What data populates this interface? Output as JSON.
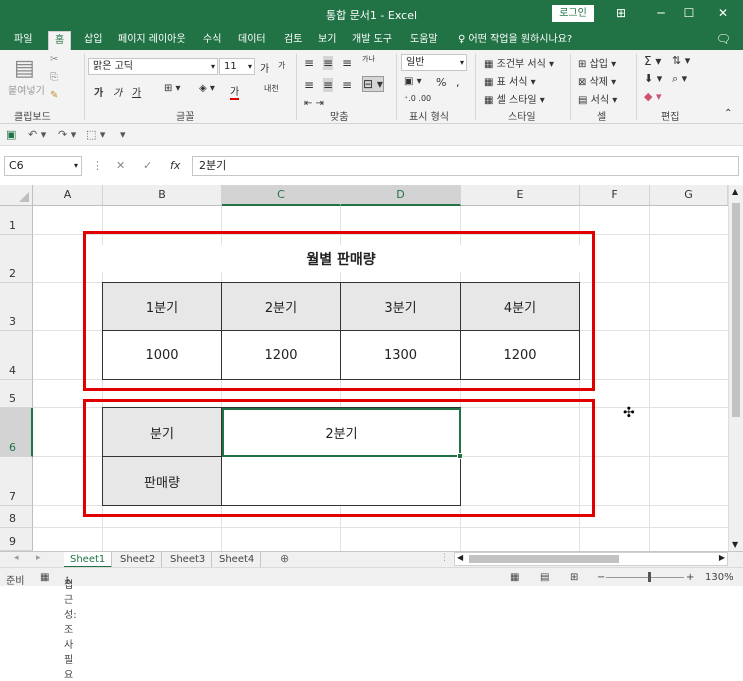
{
  "window": {
    "title": "통합 문서1 - Excel",
    "login_label": "로그인",
    "ribbon_options_icon": "ribbon-options-icon",
    "minimize": "─",
    "maximize": "☐",
    "close": "✕"
  },
  "menu": {
    "tabs": [
      "파일",
      "홈",
      "삽입",
      "페이지 레이아웃",
      "수식",
      "데이터",
      "검토",
      "보기",
      "개발 도구",
      "도움말"
    ],
    "tell_me": "어떤 작업을 원하시나요?"
  },
  "ribbon": {
    "clipboard": {
      "paste": "붙여넣기",
      "label": "클립보드"
    },
    "font": {
      "name": "맑은 고딕",
      "size": "11",
      "label": "글꼴",
      "bold": "가",
      "italic": "가",
      "underline": "가",
      "grow": "가",
      "shrink": "가",
      "font_color_label": "가",
      "phonetic": "내천"
    },
    "alignment": {
      "label": "맞춤",
      "wrap": "가나"
    },
    "number": {
      "format": "일반",
      "label": "표시 형식",
      "percent": "%",
      "comma": ","
    },
    "styles": {
      "conditional": "조건부 서식",
      "table": "표 서식",
      "cell_styles": "셀 스타일",
      "label": "스타일"
    },
    "cells": {
      "insert": "삽입",
      "delete": "삭제",
      "format": "서식",
      "label": "셀"
    },
    "editing": {
      "label": "편집"
    }
  },
  "formula_bar": {
    "name_box": "C6",
    "fx": "fx",
    "value": "2분기"
  },
  "columns": [
    "A",
    "B",
    "C",
    "D",
    "E",
    "F",
    "G"
  ],
  "rows": [
    "1",
    "2",
    "3",
    "4",
    "5",
    "6",
    "7",
    "8",
    "9"
  ],
  "selected_cell": {
    "column": "C",
    "row": "6"
  },
  "sheet": {
    "title": "월별 판매량",
    "quarters": [
      "1분기",
      "2분기",
      "3분기",
      "4분기"
    ],
    "sales": [
      "1000",
      "1200",
      "1300",
      "1200"
    ],
    "lookup": {
      "label_quarter": "분기",
      "value_quarter": "2분기",
      "label_sales": "판매량",
      "value_sales": ""
    }
  },
  "sheet_tabs": [
    "Sheet1",
    "Sheet2",
    "Sheet3",
    "Sheet4"
  ],
  "active_sheet": "Sheet1",
  "status": {
    "ready": "준비",
    "accessibility": "접근성: 조사 필요",
    "zoom": "130%"
  },
  "colors": {
    "excel_green": "#217346",
    "highlight_red": "#e00000",
    "header_fill": "#e7e7e7"
  }
}
